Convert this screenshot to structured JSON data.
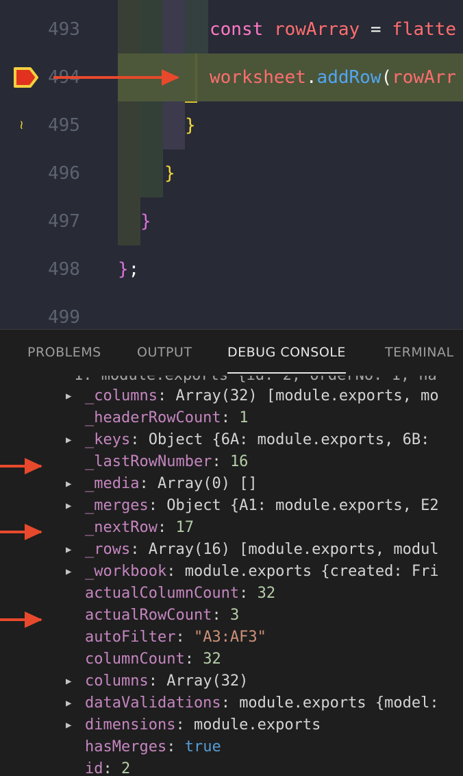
{
  "editor": {
    "lines": [
      {
        "num": "493",
        "tokens": [
          [
            "kw",
            "const"
          ],
          [
            "pl",
            " "
          ],
          [
            "var",
            "rowArray"
          ],
          [
            "pl",
            " = "
          ],
          [
            "var",
            "flatte"
          ]
        ]
      },
      {
        "num": "494",
        "tokens": [
          [
            "var",
            "worksheet"
          ],
          [
            "pl",
            "."
          ],
          [
            "fn",
            "addRow"
          ],
          [
            "pl",
            "("
          ],
          [
            "var",
            "rowArr"
          ]
        ]
      },
      {
        "num": "495",
        "tokens": [
          [
            "brace-y",
            "}"
          ]
        ]
      },
      {
        "num": "496",
        "tokens": [
          [
            "brace-y",
            "}"
          ]
        ]
      },
      {
        "num": "497",
        "tokens": [
          [
            "brace-p",
            "}"
          ]
        ]
      },
      {
        "num": "498",
        "tokens": [
          [
            "brace-p",
            "}"
          ],
          [
            "pl",
            ";"
          ]
        ]
      },
      {
        "num": "499",
        "tokens": []
      }
    ]
  },
  "colors": {
    "breakpoint_fill": "#e0321f",
    "breakpoint_outline": "#f4d03f",
    "annotation_arrow": "#e8492c"
  },
  "panel": {
    "tabs": [
      {
        "label": "PROBLEMS",
        "active": false
      },
      {
        "label": "OUTPUT",
        "active": false
      },
      {
        "label": "DEBUG CONSOLE",
        "active": true
      },
      {
        "label": "TERMINAL",
        "active": false
      }
    ]
  },
  "console": {
    "partial_top": "1: module.exports {id: 2, orderNo: 1, na",
    "rows": [
      {
        "expand": true,
        "key": "_columns",
        "parts": [
          [
            "v",
            "Array(32) [module.exports, mo"
          ]
        ]
      },
      {
        "expand": false,
        "key": "_headerRowCount",
        "parts": [
          [
            "n",
            "1"
          ]
        ]
      },
      {
        "expand": true,
        "key": "_keys",
        "parts": [
          [
            "v",
            "Object {6A: module.exports, 6B: "
          ]
        ]
      },
      {
        "expand": false,
        "key": "_lastRowNumber",
        "parts": [
          [
            "n",
            "16"
          ]
        ]
      },
      {
        "expand": true,
        "key": "_media",
        "parts": [
          [
            "v",
            "Array(0) []"
          ]
        ]
      },
      {
        "expand": true,
        "key": "_merges",
        "parts": [
          [
            "v",
            "Object {A1: module.exports, E2"
          ]
        ]
      },
      {
        "expand": false,
        "key": "_nextRow",
        "parts": [
          [
            "n",
            "17"
          ]
        ]
      },
      {
        "expand": true,
        "key": "_rows",
        "parts": [
          [
            "v",
            "Array(16) [module.exports, modul"
          ]
        ]
      },
      {
        "expand": true,
        "key": "_workbook",
        "parts": [
          [
            "v",
            "module.exports {created: Fri"
          ]
        ]
      },
      {
        "expand": false,
        "key": "actualColumnCount",
        "parts": [
          [
            "n",
            "32"
          ]
        ]
      },
      {
        "expand": false,
        "key": "actualRowCount",
        "parts": [
          [
            "n",
            "3"
          ]
        ]
      },
      {
        "expand": false,
        "key": "autoFilter",
        "parts": [
          [
            "s",
            "\"A3:AF3\""
          ]
        ]
      },
      {
        "expand": false,
        "key": "columnCount",
        "parts": [
          [
            "n",
            "32"
          ]
        ]
      },
      {
        "expand": true,
        "key": "columns",
        "parts": [
          [
            "v",
            "Array(32)"
          ]
        ]
      },
      {
        "expand": true,
        "key": "dataValidations",
        "parts": [
          [
            "v",
            "module.exports {model:"
          ]
        ]
      },
      {
        "expand": true,
        "key": "dimensions",
        "parts": [
          [
            "v",
            "module.exports"
          ]
        ]
      },
      {
        "expand": false,
        "key": "hasMerges",
        "parts": [
          [
            "b",
            "true"
          ]
        ]
      },
      {
        "expand": false,
        "key": "id",
        "parts": [
          [
            "n",
            "2"
          ]
        ]
      }
    ]
  }
}
